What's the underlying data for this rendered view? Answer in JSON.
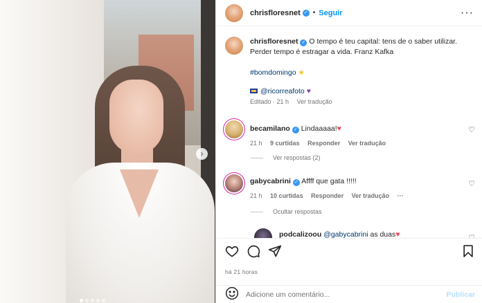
{
  "header": {
    "username": "chrisfloresnet",
    "verified_icon": "verified-badge-icon",
    "separator": "•",
    "follow_label": "Seguir",
    "more_icon": "more-options-icon"
  },
  "caption": {
    "username": "chrisfloresnet",
    "text_line1": "O tempo é teu capital: tens de o saber utilizar.",
    "text_line2": "Perder tempo é estragar a vida. Franz Kafka",
    "hashtag": "#bomdomingo",
    "hashtag_emoji": "★",
    "credit_mention": "@ricorreafoto",
    "credit_emoji": "♥",
    "edited": "Editado · 21 h",
    "see_translation": "Ver tradução"
  },
  "comments": [
    {
      "username": "becamilano",
      "text": "Lindaaaaa!",
      "emoji": "♥",
      "time": "21 h",
      "likes": "9 curtidas",
      "reply": "Responder",
      "translate": "Ver tradução",
      "replies_toggle": "Ver respostas (2)"
    },
    {
      "username": "gabycabrini",
      "text": "Affff que gata !!!!!",
      "time": "21 h",
      "likes": "10 curtidas",
      "reply": "Responder",
      "translate": "Ver tradução",
      "more": "···",
      "replies_toggle": "Ocultar respostas"
    }
  ],
  "reply": {
    "username": "podcalizoou",
    "mention": "@gabycabrini",
    "text": "as duas",
    "emoji": "♥"
  },
  "actions": {
    "like_icon": "heart-outline-icon",
    "comment_icon": "comment-icon",
    "share_icon": "share-icon",
    "save_icon": "bookmark-icon"
  },
  "posted_time": "há 21 horas",
  "add_comment": {
    "emoji_icon": "emoji-icon",
    "placeholder": "Adicione um comentário...",
    "publish_label": "Publicar"
  },
  "carousel": {
    "next_icon": "chevron-right-icon",
    "slide_count": 5,
    "active_index": 0
  },
  "colors": {
    "link_blue": "#0095f6",
    "mention_blue": "#00376b",
    "verified_blue": "#3897f0",
    "muted": "#737373",
    "heart_red": "#ed4956"
  }
}
